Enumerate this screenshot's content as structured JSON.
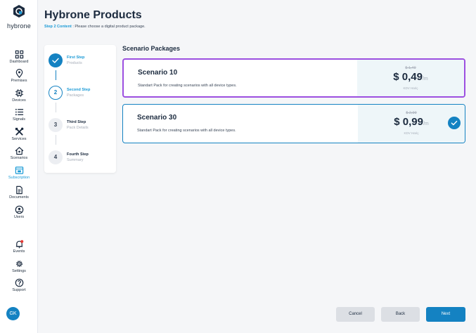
{
  "brand": {
    "name": "hybrone"
  },
  "sidebar": {
    "items": [
      {
        "label": "Dashboard",
        "icon": "grid-icon"
      },
      {
        "label": "Premises",
        "icon": "location-pin-icon"
      },
      {
        "label": "Devices",
        "icon": "chip-icon"
      },
      {
        "label": "Signals",
        "icon": "list-icon"
      },
      {
        "label": "Services",
        "icon": "tools-icon"
      },
      {
        "label": "Scenarios",
        "icon": "home-icon"
      },
      {
        "label": "Subscription",
        "icon": "subscription-icon",
        "active": true
      },
      {
        "label": "Documents",
        "icon": "document-icon"
      },
      {
        "label": "Users",
        "icon": "user-icon"
      }
    ],
    "bottom_items": [
      {
        "label": "Events",
        "icon": "bell-icon"
      },
      {
        "label": "Settings",
        "icon": "gear-icon"
      },
      {
        "label": "Support",
        "icon": "help-icon"
      }
    ],
    "avatar_initials": "GK"
  },
  "header": {
    "title": "Hybrone Products",
    "step_label": "Step 2 Content",
    "step_text": ": Please choose a digital product package."
  },
  "stepper": {
    "steps": [
      {
        "number": "1",
        "title": "First Step",
        "subtitle": "Products",
        "state": "done"
      },
      {
        "number": "2",
        "title": "Second Step",
        "subtitle": "Packages",
        "state": "current"
      },
      {
        "number": "3",
        "title": "Third Step",
        "subtitle": "Pack Details",
        "state": "todo"
      },
      {
        "number": "4",
        "title": "Fourth Step",
        "subtitle": "Summary",
        "state": "todo"
      }
    ]
  },
  "packages": {
    "section_title": "Scenario Packages",
    "items": [
      {
        "name": "Scenario 10",
        "description": "Standart Pack for creating scenarios with all device types.",
        "old_price": "$ 1,49",
        "price": "$ 0,49",
        "unit": "/m",
        "tax_note": "KDV Hariç",
        "selected": false
      },
      {
        "name": "Scenario 30",
        "description": "Standart Pack for creating scenarios with all device types.",
        "old_price": "$ 2,99",
        "price": "$ 0,99",
        "unit": "/m",
        "tax_note": "KDV Hariç",
        "selected": true
      }
    ]
  },
  "actions": {
    "cancel": "Cancel",
    "back": "Back",
    "next": "Next"
  },
  "colors": {
    "accent": "#1482c2",
    "highlight": "#9c4fe0",
    "step_text": "#1a9ad6"
  }
}
